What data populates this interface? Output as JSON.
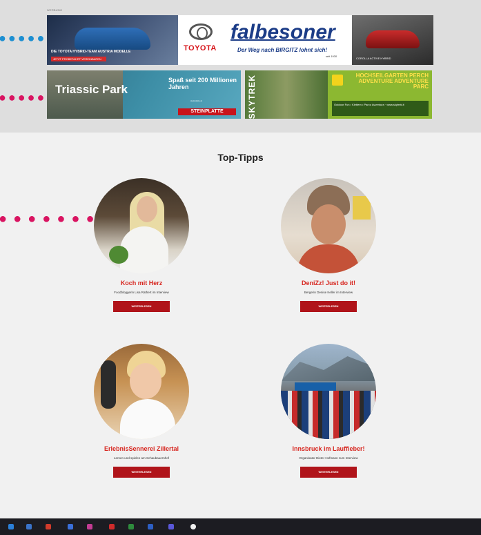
{
  "ad_area": {
    "label": "WERBUNG",
    "banner_top": {
      "left_caption": "DIE TOYOTA HYBRID-TEAM AUSTRIA MODELLE",
      "left_button": "JETZT PROBEFAHRT VEREINBAREN",
      "toyota_word": "TOYOTA",
      "brand": "falbesoner",
      "tagline": "Der Weg nach BIRGITZ lohnt sich!",
      "since": "seit 1930",
      "right_caption": "COROLLA ACTIVE HYBRID"
    },
    "banner_left": {
      "title": "Triassic Park",
      "spass": "Spaß seit 200 Millionen Jahren",
      "small": "steinplatte.at",
      "brand": "STEINPLATTE"
    },
    "banner_right": {
      "vertical": "SKYTREK",
      "headline": "HOCHSEILGARTEN PERCH ADVENTURE ADVENTURE PARC",
      "details": "Outdoor Fun • Klettern • Parco Avventura · www.skytrek.it"
    }
  },
  "main": {
    "title": "Top-Tipps",
    "tips": [
      {
        "name": "Koch mit Herz",
        "desc": "Foodbloggerin Lisa Rathert im Interview",
        "button": "WEITERLESEN"
      },
      {
        "name": "DeniZz! Just do it!",
        "desc": "Bergerin Denise Keller im Interview",
        "button": "WEITERLESEN"
      },
      {
        "name": "ErlebnisSennerei Zillertal",
        "desc": "Lernen und spielen am Schaubauernhof",
        "button": "WEITERLESEN"
      },
      {
        "name": "Innsbruck im Lauffieber!",
        "desc": "Organisator Dieter Hofmann zum Interview",
        "button": "WEITERLESEN"
      }
    ]
  },
  "decorations": {
    "dot_color_blue": "#1d8fd1",
    "dot_color_pink": "#d91461",
    "accent_red": "#d7261f",
    "button_red": "#b0141a"
  }
}
